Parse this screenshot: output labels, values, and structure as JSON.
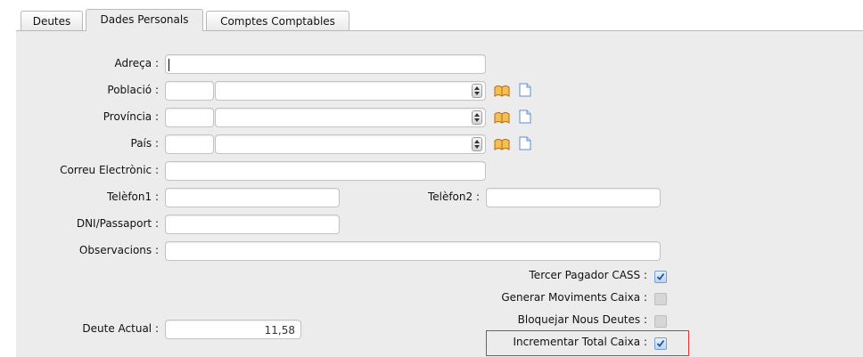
{
  "tabs": [
    {
      "label": "Deutes"
    },
    {
      "label": "Dades Personals"
    },
    {
      "label": "Comptes Comptables"
    }
  ],
  "form": {
    "address_label": "Adreça :",
    "address_value": "",
    "city_label": "Població :",
    "province_label": "Província :",
    "country_label": "País :",
    "email_label": "Correu Electrònic :",
    "phone1_label": "Telèfon1 :",
    "phone2_label": "Telèfon2 :",
    "id_label": "DNI/Passaport :",
    "notes_label": "Observacions :",
    "current_debt_label": "Deute Actual :",
    "current_debt_value": "11,58"
  },
  "options": [
    {
      "label": "Tercer Pagador CASS :",
      "checked": true
    },
    {
      "label": "Generar Moviments Caixa :",
      "checked": false
    },
    {
      "label": "Bloquejar Nous Deutes :",
      "checked": false
    },
    {
      "label": "Incrementar Total Caixa :",
      "checked": true
    }
  ],
  "icons": {
    "lookup": "book-lookup-icon",
    "new": "new-document-icon"
  },
  "colors": {
    "highlight_border": "#e03030",
    "panel_bg": "#ececec"
  }
}
